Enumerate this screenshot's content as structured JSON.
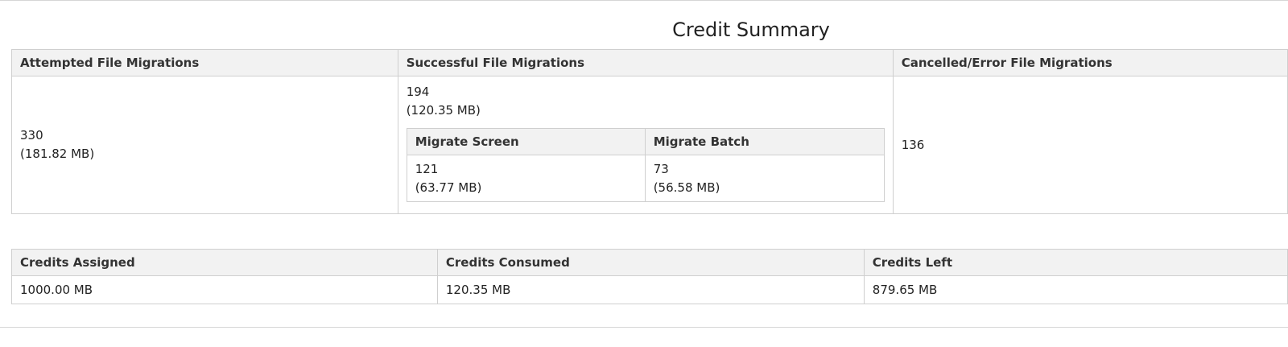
{
  "title": "Credit Summary",
  "migrations": {
    "headers": {
      "attempted": "Attempted File Migrations",
      "successful": "Successful File Migrations",
      "cancelled": "Cancelled/Error File Migrations"
    },
    "attempted": {
      "count": "330",
      "size": "(181.82 MB)"
    },
    "successful": {
      "count": "194",
      "size": "(120.35 MB)",
      "breakdown": {
        "headers": {
          "screen": "Migrate Screen",
          "batch": "Migrate Batch"
        },
        "screen": {
          "count": "121",
          "size": "(63.77 MB)"
        },
        "batch": {
          "count": "73",
          "size": "(56.58 MB)"
        }
      }
    },
    "cancelled": {
      "count": "136"
    }
  },
  "credits": {
    "headers": {
      "assigned": "Credits Assigned",
      "consumed": "Credits Consumed",
      "left": "Credits Left"
    },
    "assigned": "1000.00 MB",
    "consumed": "120.35 MB",
    "left": "879.65 MB"
  }
}
